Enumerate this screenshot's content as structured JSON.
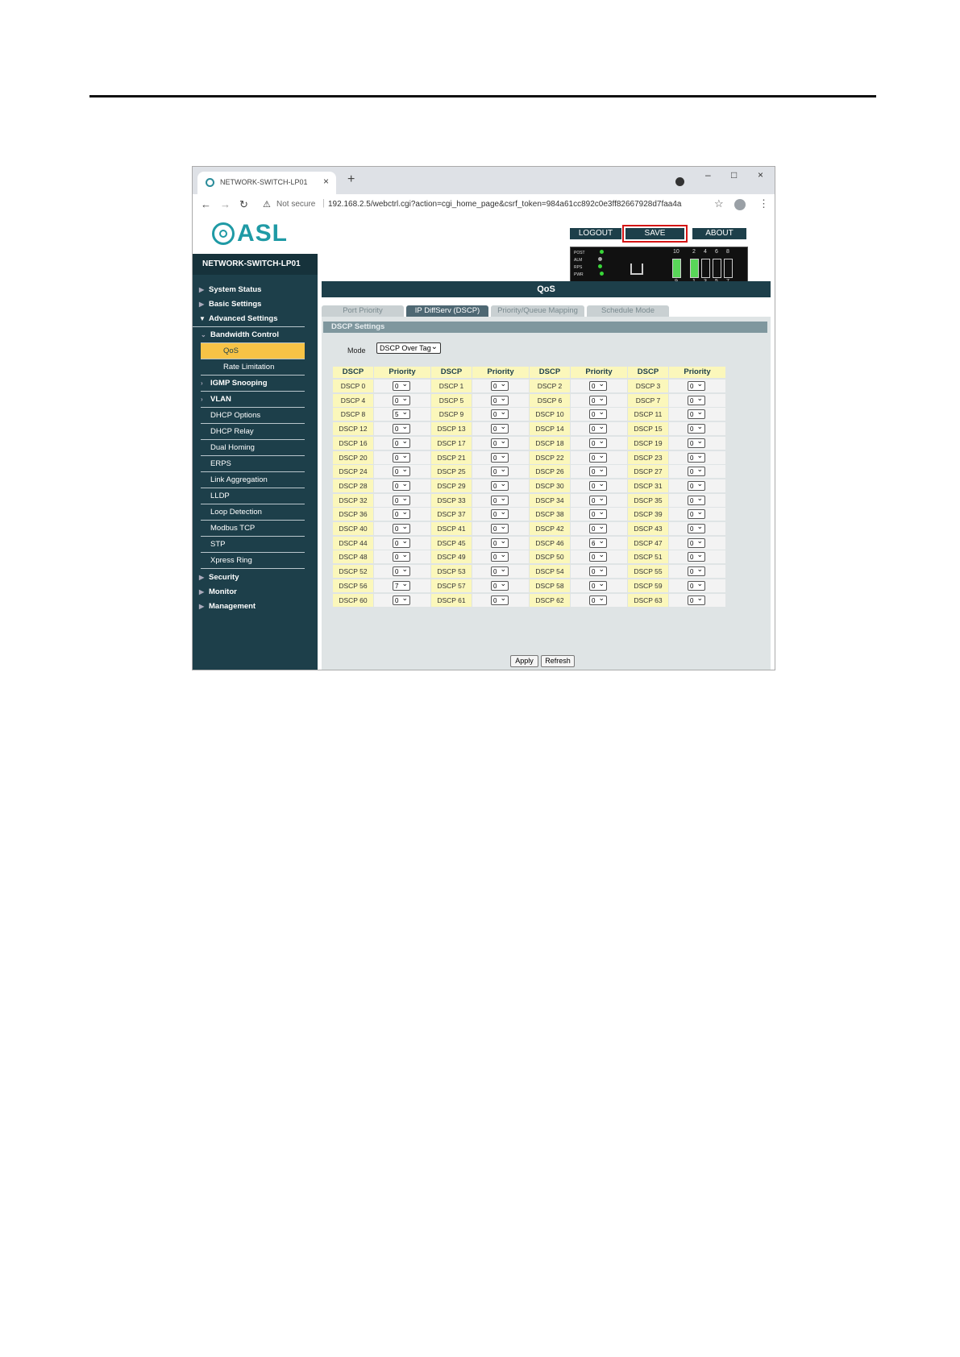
{
  "browser": {
    "tab_title": "NETWORK-SWITCH-LP01",
    "tab_close": "×",
    "new_tab": "+",
    "win_minimize": "–",
    "win_maximize": "□",
    "win_close": "×",
    "security_label": "Not secure",
    "url": "192.168.2.5/webctrl.cgi?action=cgi_home_page&csrf_token=984a61cc892c0e3ff82667928d7faa4a"
  },
  "header": {
    "logo_text": "ASL",
    "buttons": {
      "logout": "LOGOUT",
      "save": "SAVE",
      "about": "ABOUT"
    },
    "highlight_color": "#d41414"
  },
  "device": {
    "leds": [
      "POST",
      "ALM",
      "RPS",
      "PWR"
    ],
    "port_numbers_top": [
      "10",
      "2",
      "4",
      "6",
      "8"
    ],
    "port_numbers_bottom": [
      "9",
      "1",
      "3",
      "5",
      "7"
    ]
  },
  "sidebar": {
    "device_name": "NETWORK-SWITCH-LP01",
    "items": [
      {
        "label": "System Status",
        "arrow": "▶"
      },
      {
        "label": "Basic Settings",
        "arrow": "▶"
      },
      {
        "label": "Advanced Settings",
        "arrow": "▼"
      },
      {
        "label": "Bandwidth Control",
        "arrow": "⌄"
      },
      {
        "label": "QoS"
      },
      {
        "label": "Rate Limitation"
      },
      {
        "label": "IGMP Snooping",
        "arrow": "›"
      },
      {
        "label": "VLAN",
        "arrow": "›"
      },
      {
        "label": "DHCP Options"
      },
      {
        "label": "DHCP Relay"
      },
      {
        "label": "Dual Homing"
      },
      {
        "label": "ERPS"
      },
      {
        "label": "Link Aggregation"
      },
      {
        "label": "LLDP"
      },
      {
        "label": "Loop Detection"
      },
      {
        "label": "Modbus TCP"
      },
      {
        "label": "STP"
      },
      {
        "label": "Xpress Ring"
      },
      {
        "label": "Security",
        "arrow": "▶"
      },
      {
        "label": "Monitor",
        "arrow": "▶"
      },
      {
        "label": "Management",
        "arrow": "▶"
      }
    ]
  },
  "main": {
    "title": "QoS",
    "tabs": [
      "Port Priority",
      "IP DiffServ (DSCP)",
      "Priority/Queue Mapping",
      "Schedule Mode"
    ],
    "active_tab": "IP DiffServ (DSCP)",
    "section_title": "DSCP Settings",
    "mode_label": "Mode",
    "mode_value": "DSCP Over Tag",
    "col_headers": [
      "DSCP",
      "Priority",
      "DSCP",
      "Priority",
      "DSCP",
      "Priority",
      "DSCP",
      "Priority"
    ],
    "priorities": [
      0,
      0,
      0,
      0,
      0,
      0,
      0,
      0,
      5,
      0,
      0,
      0,
      0,
      0,
      0,
      0,
      0,
      0,
      0,
      0,
      0,
      0,
      0,
      0,
      0,
      0,
      0,
      0,
      0,
      0,
      0,
      0,
      0,
      0,
      0,
      0,
      0,
      0,
      0,
      0,
      0,
      0,
      0,
      0,
      0,
      0,
      6,
      0,
      0,
      0,
      0,
      0,
      0,
      0,
      0,
      0,
      7,
      0,
      0,
      0,
      0,
      0,
      0,
      0
    ],
    "apply_label": "Apply",
    "refresh_label": "Refresh"
  }
}
